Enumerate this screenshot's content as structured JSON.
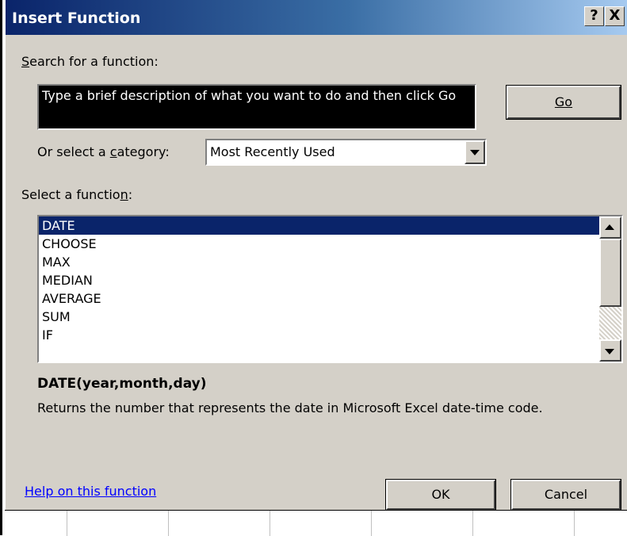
{
  "dialog": {
    "title": "Insert Function",
    "help_button": "?",
    "close_button": "X"
  },
  "search": {
    "label": "Search for a function:",
    "value": "Type a brief description of what you want to do and then click Go",
    "go_button": "Go"
  },
  "category": {
    "label": "Or select a category:",
    "selected": "Most Recently Used"
  },
  "function_list": {
    "label": "Select a function:",
    "items": [
      "DATE",
      "CHOOSE",
      "MAX",
      "MEDIAN",
      "AVERAGE",
      "SUM",
      "IF"
    ],
    "selected_index": 0
  },
  "details": {
    "syntax": "DATE(year,month,day)",
    "description": "Returns the number that represents the date in Microsoft Excel date-time code."
  },
  "footer": {
    "help_link": "Help on this function",
    "ok_button": "OK",
    "cancel_button": "Cancel"
  },
  "colors": {
    "title_bar_start": "#0a246a",
    "title_bar_end": "#a6caf0",
    "dialog_face": "#d4d0c8",
    "selection": "#0a246a",
    "link": "#0000ff"
  }
}
